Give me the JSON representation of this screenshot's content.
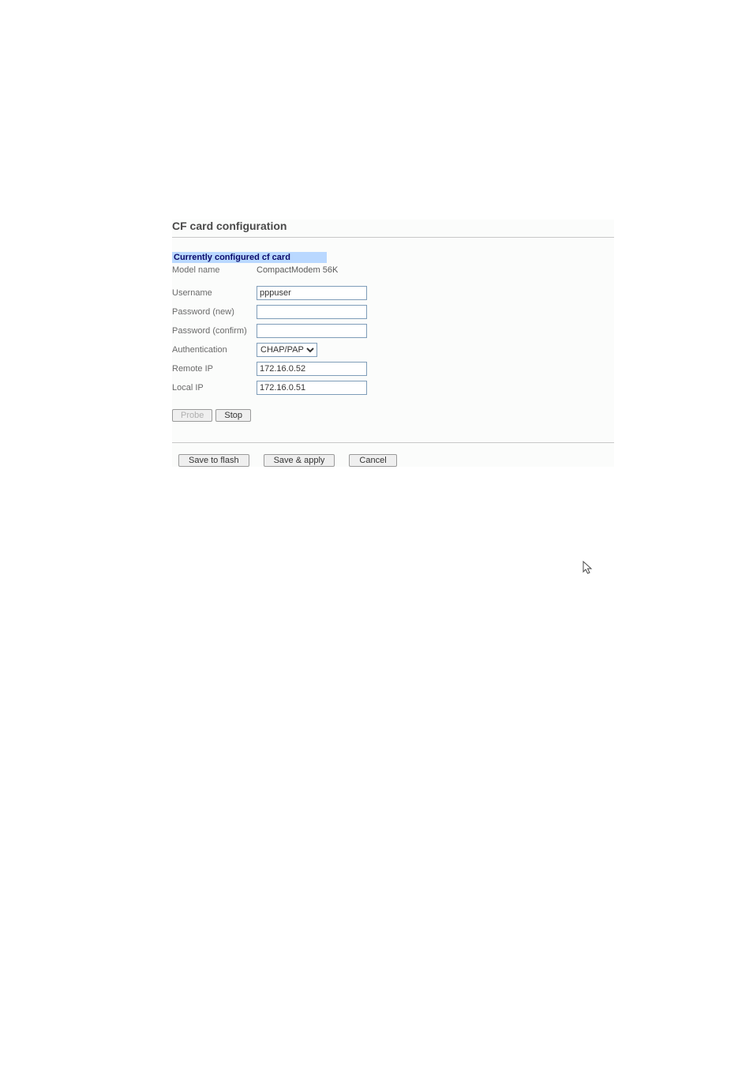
{
  "panel": {
    "title": "CF card configuration",
    "section_header": "Currently configured cf card",
    "model_name_label": "Model name",
    "model_name_value": "CompactModem 56K",
    "username_label": "Username",
    "username_value": "pppuser",
    "password_new_label": "Password (new)",
    "password_new_value": "",
    "password_confirm_label": "Password (confirm)",
    "password_confirm_value": "",
    "authentication_label": "Authentication",
    "authentication_value": "CHAP/PAP",
    "remote_ip_label": "Remote IP",
    "remote_ip_value": "172.16.0.52",
    "local_ip_label": "Local IP",
    "local_ip_value": "172.16.0.51",
    "probe_label": "Probe",
    "stop_label": "Stop",
    "save_flash_label": "Save to flash",
    "save_apply_label": "Save & apply",
    "cancel_label": "Cancel"
  }
}
